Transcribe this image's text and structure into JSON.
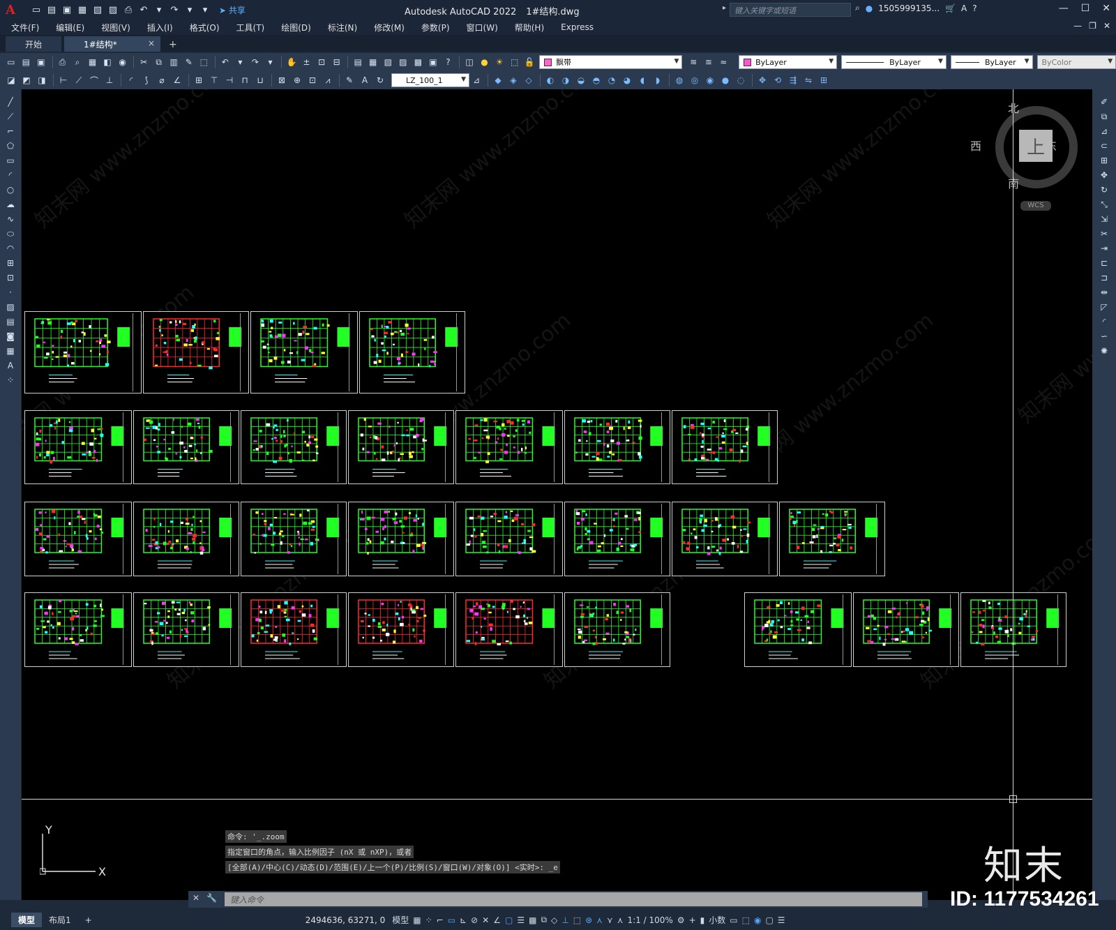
{
  "titlebar": {
    "logo": "A",
    "share_label": "共享",
    "app_name": "Autodesk AutoCAD 2022",
    "file_name": "1#结构.dwg",
    "search_placeholder": "键入关键字或短语",
    "user": "1505999135...",
    "help": "?"
  },
  "menu": [
    "文件(F)",
    "编辑(E)",
    "视图(V)",
    "插入(I)",
    "格式(O)",
    "工具(T)",
    "绘图(D)",
    "标注(N)",
    "修改(M)",
    "参数(P)",
    "窗口(W)",
    "帮助(H)",
    "Express"
  ],
  "tabs": {
    "start": "开始",
    "active": "1#结构*",
    "close": "×",
    "add": "+"
  },
  "properties": {
    "layer": "飘带",
    "color": "ByLayer",
    "linetype": "ByLayer",
    "lineweight": "ByLayer",
    "plotstyle": "ByColor",
    "layer_color": "#ff66cc",
    "color_swatch": "#ff55d0"
  },
  "dimstyle": "LZ_100_1",
  "viewcube": {
    "north": "北",
    "south": "南",
    "east": "东",
    "west": "西",
    "face": "上",
    "wcs": "WCS"
  },
  "ucs": {
    "y": "Y",
    "x": "X"
  },
  "command_history": [
    "命令: '_.zoom",
    "指定窗口的角点，输入比例因子 (nX 或 nXP)，或者",
    "[全部(A)/中心(C)/动态(D)/范围(E)/上一个(P)/比例(S)/窗口(W)/对象(O)] <实时>: _e"
  ],
  "command_placeholder": "键入命令",
  "watermark": {
    "brand": "知末",
    "id": "ID: 1177534261",
    "site": "知末网 www.znzmo.com"
  },
  "status": {
    "model_tab": "模型",
    "layout_tab": "布局1",
    "add": "+",
    "coords": "2494636, 63271, 0",
    "model": "模型",
    "scale": "1:1 / 100%",
    "units": "小数"
  },
  "colors": {
    "accent": "#57a6ff",
    "canvas": "#000000",
    "drawing_green": "#22ff22",
    "drawing_red": "#ff2a2a",
    "drawing_yellow": "#ffff33",
    "drawing_cyan": "#22ffff",
    "drawing_magenta": "#ff33ff"
  }
}
